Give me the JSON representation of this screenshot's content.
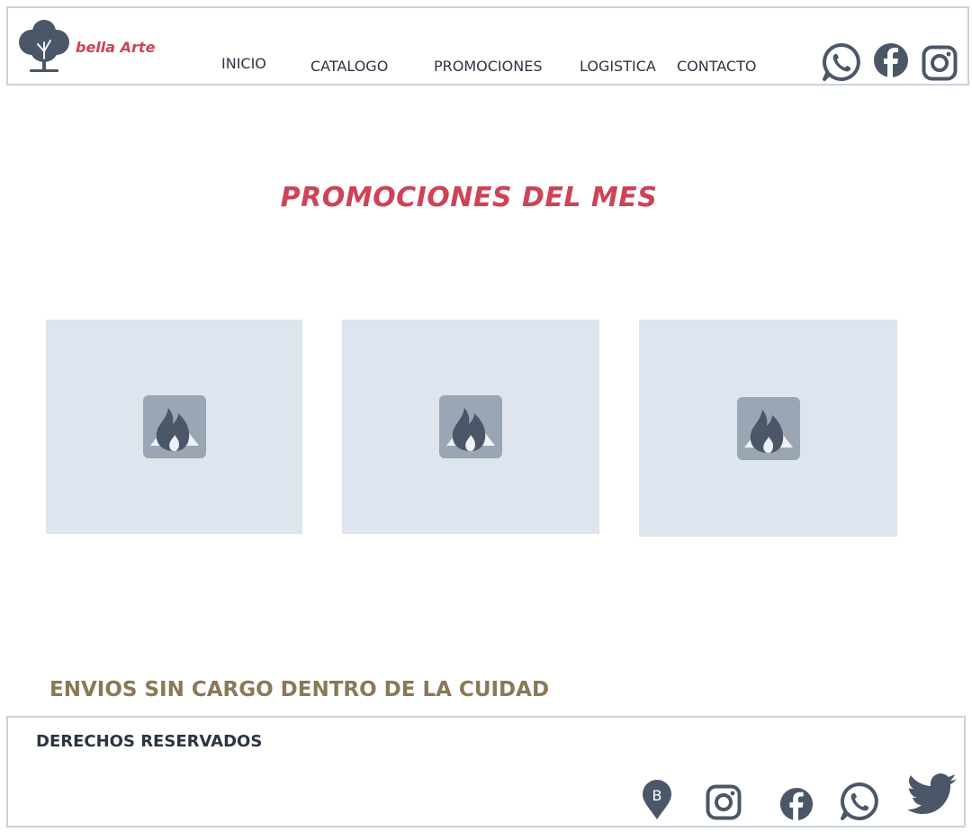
{
  "header": {
    "brand": "bella Arte",
    "nav": [
      "INICIO",
      "CATALOGO",
      "PROMOCIONES",
      "LOGISTICA",
      "CONTACTO"
    ],
    "social_icons": [
      "whatsapp-icon",
      "facebook-icon",
      "instagram-icon"
    ]
  },
  "main": {
    "title": "PROMOCIONES DEL MES",
    "promo_cards": [
      {
        "image": "image-placeholder-icon"
      },
      {
        "image": "image-placeholder-icon"
      },
      {
        "image": "image-placeholder-icon"
      }
    ],
    "shipping_note": "ENVIOS SIN CARGO DENTRO DE LA CUIDAD"
  },
  "footer": {
    "rights": "DERECHOS RESERVADOS",
    "social_icons": [
      "location-b-icon",
      "instagram-icon",
      "facebook-icon",
      "whatsapp-icon",
      "twitter-icon"
    ]
  },
  "colors": {
    "accent": "#cf4257",
    "text": "#2b3541",
    "icon": "#4b5768",
    "card_bg": "#dfe5ee",
    "shipping": "#8a7856",
    "border": "#c9d2dd"
  }
}
